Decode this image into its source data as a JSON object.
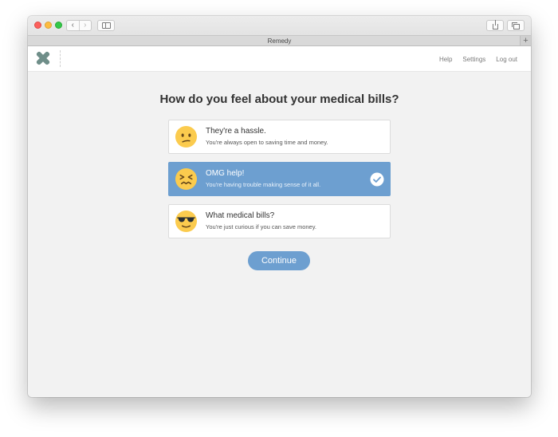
{
  "browser": {
    "tab_title": "Remedy",
    "new_tab_symbol": "+",
    "back_symbol": "‹",
    "forward_symbol": "›",
    "icons": [
      "back-icon",
      "forward-icon",
      "sidebar-icon",
      "share-icon",
      "tabs-icon"
    ]
  },
  "header": {
    "logo_icon": "remedy-x-logo-icon",
    "logo_color": "#6f8e89",
    "links": [
      "Help",
      "Settings",
      "Log out"
    ]
  },
  "main": {
    "question": "How do you feel about your medical bills?",
    "options": [
      {
        "title": "They're a hassle.",
        "subtitle": "You're always open to saving time and money.",
        "icon": "confused-face-icon",
        "selected": false
      },
      {
        "title": "OMG help!",
        "subtitle": "You're having trouble making sense of it all.",
        "icon": "confounded-face-icon",
        "selected": true
      },
      {
        "title": "What medical bills?",
        "subtitle": "You're just curious if you can save money.",
        "icon": "sunglasses-face-icon",
        "selected": false
      }
    ],
    "continue_label": "Continue"
  },
  "colors": {
    "accent": "#6d9fd0",
    "background": "#f2f2f2",
    "emoji_yellow": "#fbcb4e"
  }
}
